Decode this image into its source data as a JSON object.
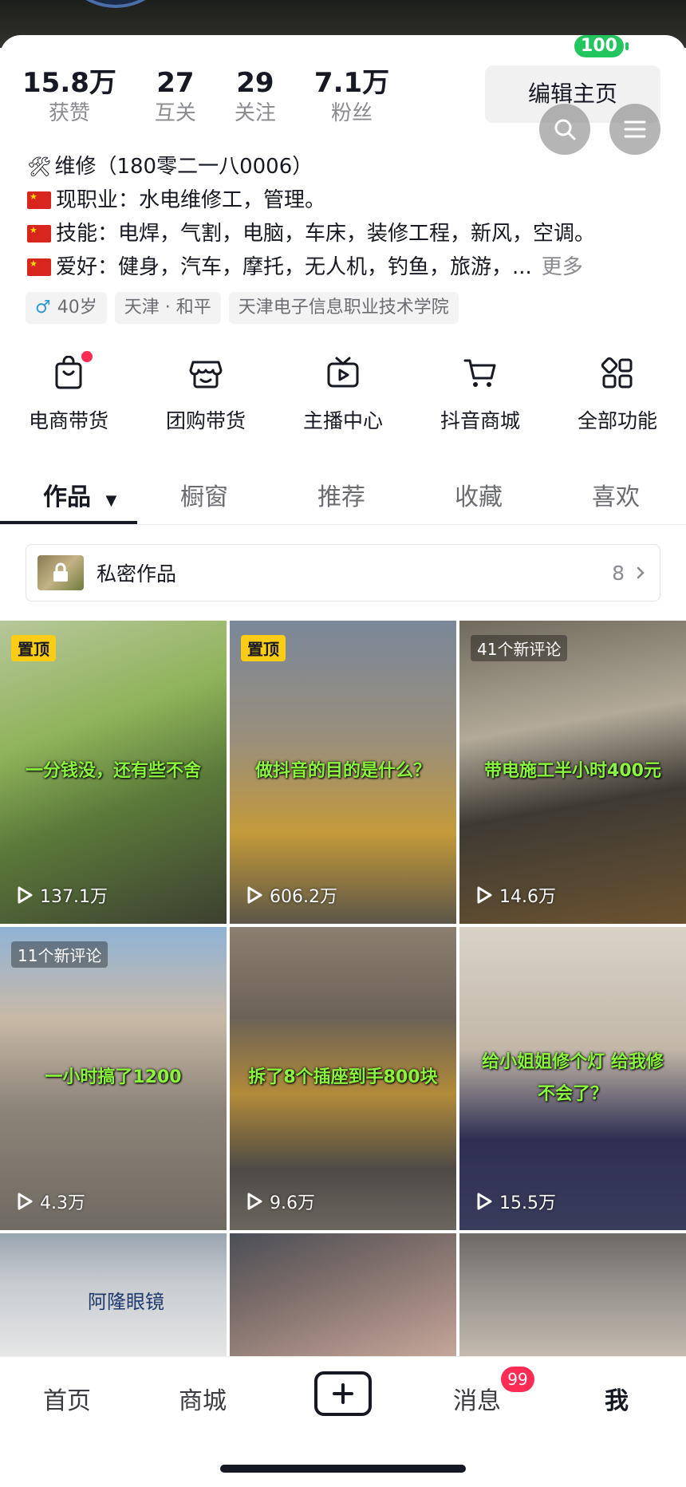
{
  "status": {
    "battery": "100"
  },
  "profile": {
    "stats": [
      {
        "num": "15.8万",
        "label": "获赞"
      },
      {
        "num": "27",
        "label": "互关"
      },
      {
        "num": "29",
        "label": "关注"
      },
      {
        "num": "7.1万",
        "label": "粉丝"
      }
    ],
    "edit_label": "编辑主页",
    "bio": [
      "维修（180零二一八0006）",
      "现职业：水电维修工，管理。",
      "技能：电焊，气割，电脑，车床，装修工程，新风，空调。",
      "爱好：健身，汽车，摩托，无人机，钓鱼，旅游，..."
    ],
    "bio_more": "更多",
    "tags": [
      "40岁",
      "天津 · 和平",
      "天津电子信息职业技术学院"
    ]
  },
  "functions": [
    {
      "label": "电商带货",
      "icon": "bag-icon"
    },
    {
      "label": "团购带货",
      "icon": "store-icon"
    },
    {
      "label": "主播中心",
      "icon": "tv-play-icon"
    },
    {
      "label": "抖音商城",
      "icon": "cart-icon"
    },
    {
      "label": "全部功能",
      "icon": "grid-icon"
    }
  ],
  "tabs": [
    "作品",
    "橱窗",
    "推荐",
    "收藏",
    "喜欢"
  ],
  "private_works": {
    "label": "私密作品",
    "count": "8"
  },
  "videos": [
    {
      "badge": "置顶",
      "text": "一分钱没，还有些不舍",
      "plays": "137.1万"
    },
    {
      "badge": "置顶",
      "text": "做抖音的目的是什么？",
      "plays": "606.2万"
    },
    {
      "comments": "41个新评论",
      "text": "带电施工半小时400元",
      "plays": "14.6万"
    },
    {
      "comments": "11个新评论",
      "text": "一小时搞了1200",
      "plays": "4.3万"
    },
    {
      "text": "拆了8个插座到手800块",
      "plays": "9.6万"
    },
    {
      "text": "给小姐姐修个灯 给我修不会了？",
      "plays": "15.5万"
    },
    {
      "sign": "阿隆眼镜"
    },
    {},
    {}
  ],
  "bottom_nav": [
    "首页",
    "商城",
    "消息",
    "我"
  ],
  "messages_badge": "99",
  "colors": {
    "accent": "#fe2c55",
    "pin": "#facc15",
    "battery": "#22c55e"
  }
}
